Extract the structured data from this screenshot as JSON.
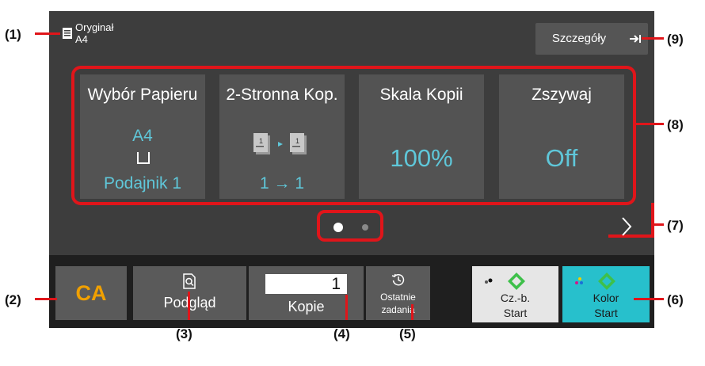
{
  "header": {
    "original_label": "Oryginał",
    "original_size": "A4",
    "details_button": "Szczegóły",
    "icons": [
      "document-icon",
      "arrow-right-icon"
    ]
  },
  "tiles": [
    {
      "title": "Wybór Papieru",
      "size": "A4",
      "value": "Podajnik 1",
      "icon": "paper-tray-icon"
    },
    {
      "title": "2-Stronna Kop.",
      "value": "1 → 1",
      "icon": "duplex-copy-icon"
    },
    {
      "title": "Skala Kopii",
      "value": "100%"
    },
    {
      "title": "Zszywaj",
      "value": "Off"
    }
  ],
  "pager": {
    "total_pages": 2,
    "current_page": 1
  },
  "bottom_bar": {
    "ca_label": "CA",
    "preview_label": "Podgląd",
    "copies_value": "1",
    "copies_label": "Kopie",
    "recent_line1": "Ostatnie",
    "recent_line2": "zadania",
    "bw_line1": "Cz.-b.",
    "bw_line2": "Start",
    "color_line1": "Kolor",
    "color_line2": "Start"
  },
  "callouts": {
    "c1": "(1)",
    "c2": "(2)",
    "c3": "(3)",
    "c4": "(4)",
    "c5": "(5)",
    "c6": "(6)",
    "c7": "(7)",
    "c8": "(8)",
    "c9": "(9)"
  },
  "colors": {
    "panel": "#3d3d3d",
    "tile": "#535353",
    "accent_cyan": "#5fc7d9",
    "callout_red": "#e0151a",
    "ca_orange": "#f0a000",
    "color_start": "#27c0cc",
    "start_green": "#3ec04a"
  }
}
